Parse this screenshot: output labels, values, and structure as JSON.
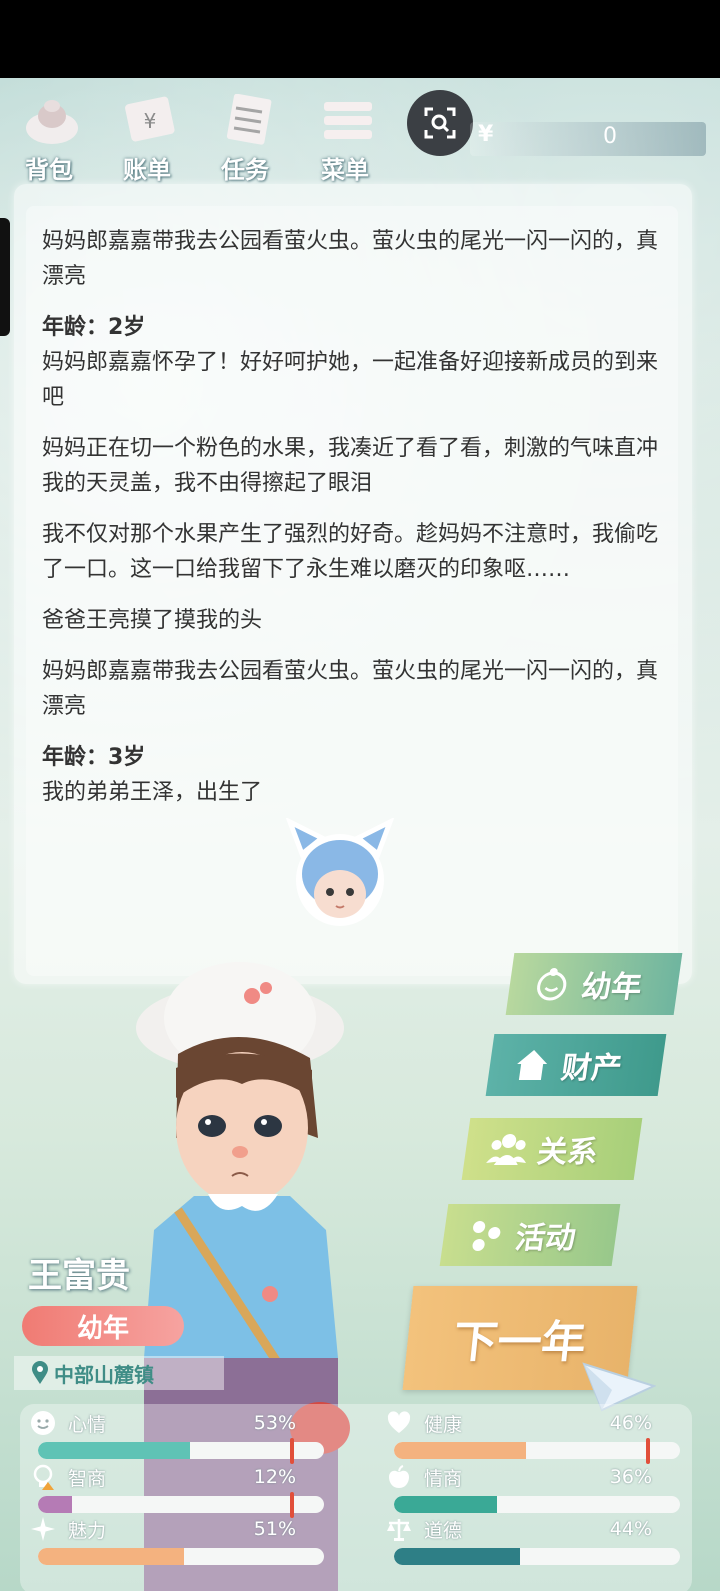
{
  "menu": {
    "items": [
      {
        "label": "背包",
        "icon": "backpack-icon"
      },
      {
        "label": "账单",
        "icon": "bill-icon"
      },
      {
        "label": "任务",
        "icon": "task-icon"
      },
      {
        "label": "菜单",
        "icon": "menu-icon"
      }
    ],
    "scan_icon": "scan-icon"
  },
  "money": {
    "symbol": "¥",
    "value": "0"
  },
  "story": {
    "entries": [
      {
        "text": "妈妈郎嘉嘉带我去公园看萤火虫。萤火虫的尾光一闪一闪的，真漂亮"
      },
      {
        "age": "年龄：2岁",
        "text": "妈妈郎嘉嘉怀孕了！好好呵护她，一起准备好迎接新成员的到来吧"
      },
      {
        "text": "妈妈正在切一个粉色的水果，我凑近了看了看，刺激的气味直冲我的天灵盖，我不由得擦起了眼泪"
      },
      {
        "text": "我不仅对那个水果产生了强烈的好奇。趁妈妈不注意时，我偷吃了一口。这一口给我留下了永生难以磨灭的印象呕……"
      },
      {
        "text": "爸爸王亮摸了摸我的头"
      },
      {
        "text": "妈妈郎嘉嘉带我去公园看萤火虫。萤火虫的尾光一闪一闪的，真漂亮"
      },
      {
        "age": "年龄：3岁",
        "text": "我的弟弟王泽，出生了"
      }
    ]
  },
  "side_buttons": {
    "youth": "幼年",
    "assets": "财产",
    "relations": "关系",
    "activity": "活动"
  },
  "next_year": "下一年",
  "player": {
    "name": "王富贵",
    "stage": "幼年",
    "location": "中部山麓镇"
  },
  "stats": {
    "mood": {
      "label": "心情",
      "value": "53%",
      "level": 0.53,
      "color": "#5fc3b5"
    },
    "health": {
      "label": "健康",
      "value": "46%",
      "level": 0.46,
      "color": "#f4b27f"
    },
    "iq": {
      "label": "智商",
      "value": "12%",
      "level": 0.12,
      "color": "#b57bb5"
    },
    "eq": {
      "label": "情商",
      "value": "36%",
      "level": 0.36,
      "color": "#3aa996"
    },
    "charm": {
      "label": "魅力",
      "value": "51%",
      "level": 0.51,
      "color": "#f4b27f"
    },
    "morality": {
      "label": "道德",
      "value": "44%",
      "level": 0.44,
      "color": "#2e7f86"
    }
  }
}
